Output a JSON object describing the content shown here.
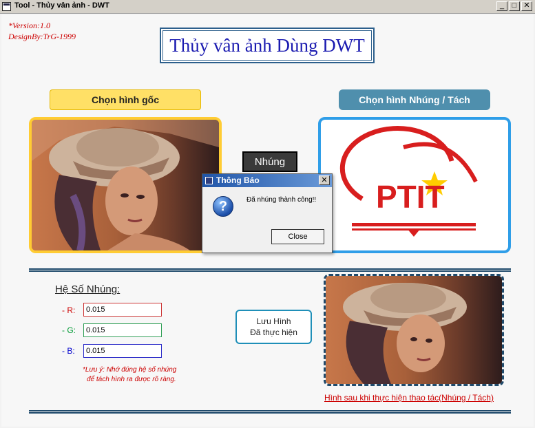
{
  "window": {
    "title": "Tool - Thủy vân ảnh  - DWT",
    "minimize": "_",
    "maximize": "□",
    "close": "✕"
  },
  "header": {
    "version": "*Version:1.0",
    "design_by": "DesignBy:TrG-1999",
    "app_title": "Thủy vân ảnh Dùng DWT"
  },
  "top": {
    "choose_original_label": "Chọn hình gốc",
    "choose_embed_label": "Chọn hình Nhúng / Tách",
    "embed_button_label": "Nhúng",
    "logo_text": "PTIT"
  },
  "coefficients": {
    "title": "Hệ Số Nhúng:",
    "r_label": "- R:",
    "g_label": "- G:",
    "b_label": "- B:",
    "r_value": "0.015",
    "g_value": "0.015",
    "b_value": "0.015",
    "note_line1": "*Lưu ý: Nhớ đúng hệ số nhúng",
    "note_line2": "để tách hình ra được rõ ràng.",
    "r_color": "#cc0000",
    "g_color": "#009933",
    "b_color": "#0000cc"
  },
  "save": {
    "line1": "Lưu Hình",
    "line2": "Đã thực hiện"
  },
  "result": {
    "caption": "Hình sau khi thực hiện thao tác(Nhúng / Tách)"
  },
  "dialog": {
    "title": "Thông Báo",
    "message": "Đã nhúng thành công!!",
    "close_label": "Close",
    "close_x": "✕"
  }
}
